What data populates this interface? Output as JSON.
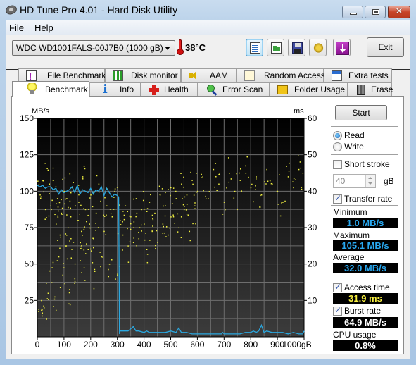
{
  "window": {
    "title": "HD Tune Pro 4.01 - Hard Disk Utility",
    "controls": {
      "minimize": "minimize",
      "maximize": "maximize",
      "close": "✕"
    }
  },
  "menu": [
    {
      "label": "File",
      "accel": "F"
    },
    {
      "label": "Help",
      "accel": "H"
    }
  ],
  "toolbar": {
    "drive": "WDC WD1001FALS-00J7B0 (1000 gB)",
    "temperature": "38°C",
    "buttons": [
      {
        "name": "copy-text",
        "icon": "copy-text-icon"
      },
      {
        "name": "copy-screenshot",
        "icon": "copy-screenshot-icon"
      },
      {
        "name": "save",
        "icon": "floppy-disk-icon"
      },
      {
        "name": "options",
        "icon": "gears-icon"
      },
      {
        "name": "minimize-to-tray",
        "icon": "download-arrow-icon"
      }
    ],
    "exit_label": "Exit"
  },
  "tabs_top": [
    {
      "label": "File Benchmark",
      "icon": "file-benchmark-icon"
    },
    {
      "label": "Disk monitor",
      "icon": "disk-monitor-icon"
    },
    {
      "label": "AAM",
      "icon": "speaker-icon"
    },
    {
      "label": "Random Access",
      "icon": "random-access-icon"
    },
    {
      "label": "Extra tests",
      "icon": "extra-tests-icon"
    }
  ],
  "tabs_bottom": [
    {
      "label": "Benchmark",
      "icon": "lightbulb-icon",
      "selected": true
    },
    {
      "label": "Info",
      "icon": "info-icon"
    },
    {
      "label": "Health",
      "icon": "health-cross-icon"
    },
    {
      "label": "Error Scan",
      "icon": "magnifier-icon"
    },
    {
      "label": "Folder Usage",
      "icon": "folder-icon"
    },
    {
      "label": "Erase",
      "icon": "trash-icon"
    }
  ],
  "benchmark": {
    "start_label": "Start",
    "mode_options": [
      {
        "label": "Read",
        "selected": true
      },
      {
        "label": "Write",
        "selected": false
      }
    ],
    "short_stroke": {
      "label": "Short stroke",
      "checked": false,
      "value": "40",
      "unit": "gB"
    },
    "transfer_rate": {
      "label": "Transfer rate",
      "checked": true
    },
    "minimum": {
      "label": "Minimum",
      "value": "1.0 MB/s"
    },
    "maximum": {
      "label": "Maximum",
      "value": "105.1 MB/s"
    },
    "average": {
      "label": "Average",
      "value": "32.0 MB/s"
    },
    "access_time": {
      "label": "Access time",
      "checked": true,
      "value": "31.9 ms"
    },
    "burst_rate": {
      "label": "Burst rate",
      "checked": true,
      "value": "64.9 MB/s"
    },
    "cpu_usage": {
      "label": "CPU usage",
      "value": "0.8%"
    }
  },
  "colors": {
    "transfer_line": "#2aa8e0",
    "access_dots": "#f0f040",
    "grid": "#6e6e6e",
    "readout_blue": "#28a8f0",
    "readout_yellow": "#f8f040"
  },
  "chart_data": {
    "type": "line",
    "title": "",
    "xlabel": "gB",
    "ylabel": "MB/s",
    "y2label": "ms",
    "xlim": [
      0,
      1000
    ],
    "ylim": [
      0,
      150
    ],
    "y2lim": [
      0,
      60
    ],
    "x_ticks": [
      "0",
      "100",
      "200",
      "300",
      "400",
      "500",
      "600",
      "700",
      "800",
      "900",
      "1000gB"
    ],
    "y_ticks": [
      "25",
      "50",
      "75",
      "100",
      "125",
      "150"
    ],
    "y2_ticks": [
      "10",
      "20",
      "30",
      "40",
      "50",
      "60"
    ],
    "grid": true,
    "series": [
      {
        "name": "Transfer rate (MB/s)",
        "axis": "left",
        "x": [
          0,
          10,
          20,
          30,
          40,
          50,
          60,
          70,
          80,
          90,
          100,
          110,
          120,
          130,
          140,
          150,
          160,
          170,
          180,
          190,
          200,
          210,
          220,
          230,
          240,
          250,
          260,
          270,
          280,
          290,
          300,
          305,
          308,
          310,
          320,
          340,
          360,
          370,
          380,
          400,
          410,
          420,
          450,
          480,
          500,
          520,
          530,
          540,
          560,
          580,
          600,
          650,
          690,
          695,
          700,
          760,
          780,
          800,
          810,
          820,
          830,
          840,
          850,
          860,
          880,
          900,
          920,
          940,
          960,
          980,
          995,
          1000
        ],
        "values": [
          104,
          103,
          104,
          102,
          103,
          103,
          101,
          102,
          98,
          101,
          99,
          100,
          101,
          103,
          99,
          104,
          98,
          101,
          100,
          99,
          102,
          98,
          101,
          100,
          103,
          97,
          102,
          99,
          96,
          98,
          97,
          96,
          2,
          4,
          4,
          4,
          7,
          4,
          4,
          3,
          4,
          3,
          3,
          3,
          4,
          3,
          6,
          3,
          3,
          2,
          2,
          2,
          2,
          3,
          2,
          2,
          3,
          3,
          4,
          3,
          4,
          8,
          3,
          4,
          3,
          3,
          3,
          2,
          3,
          2,
          2,
          4
        ]
      },
      {
        "name": "Access time (ms)",
        "axis": "right",
        "type": "scatter",
        "description": "~400 random seek samples; cluster 10-45 ms spread for 0-310 gB, 20-45 ms for 310-650 gB, 38-48 ms sparse above 650 gB",
        "points": [
          [
            5,
            7
          ],
          [
            10,
            39
          ],
          [
            15,
            10
          ],
          [
            20,
            43
          ],
          [
            25,
            8
          ],
          [
            30,
            35
          ],
          [
            40,
            12
          ],
          [
            45,
            42
          ],
          [
            50,
            36
          ],
          [
            55,
            19
          ],
          [
            60,
            43
          ],
          [
            65,
            11
          ],
          [
            70,
            31
          ],
          [
            75,
            38
          ],
          [
            80,
            22
          ],
          [
            85,
            28
          ],
          [
            90,
            34
          ],
          [
            95,
            17
          ],
          [
            100,
            40
          ],
          [
            105,
            25
          ],
          [
            110,
            38
          ],
          [
            115,
            30
          ],
          [
            120,
            13
          ],
          [
            125,
            33
          ],
          [
            130,
            41
          ],
          [
            135,
            26
          ],
          [
            140,
            16
          ],
          [
            150,
            32
          ],
          [
            155,
            37
          ],
          [
            160,
            21
          ],
          [
            165,
            29
          ],
          [
            170,
            44
          ],
          [
            175,
            19
          ],
          [
            180,
            35
          ],
          [
            190,
            24
          ],
          [
            195,
            31
          ],
          [
            200,
            39
          ],
          [
            210,
            27
          ],
          [
            215,
            18
          ],
          [
            220,
            34
          ],
          [
            230,
            42
          ],
          [
            240,
            22
          ],
          [
            250,
            29
          ],
          [
            260,
            36
          ],
          [
            270,
            20
          ],
          [
            280,
            33
          ],
          [
            290,
            40
          ],
          [
            300,
            17
          ],
          [
            310,
            32
          ],
          [
            320,
            28
          ],
          [
            330,
            36
          ],
          [
            340,
            25
          ],
          [
            350,
            33
          ],
          [
            360,
            30
          ],
          [
            370,
            38
          ],
          [
            380,
            27
          ],
          [
            390,
            35
          ],
          [
            400,
            31
          ],
          [
            410,
            24
          ],
          [
            420,
            37
          ],
          [
            430,
            29
          ],
          [
            440,
            34
          ],
          [
            450,
            26
          ],
          [
            460,
            39
          ],
          [
            470,
            31
          ],
          [
            480,
            36
          ],
          [
            490,
            28
          ],
          [
            500,
            41
          ],
          [
            510,
            33
          ],
          [
            520,
            38
          ],
          [
            530,
            30
          ],
          [
            540,
            42
          ],
          [
            550,
            35
          ],
          [
            560,
            39
          ],
          [
            570,
            29
          ],
          [
            580,
            43
          ],
          [
            590,
            36
          ],
          [
            600,
            40
          ],
          [
            620,
            44
          ],
          [
            640,
            38
          ],
          [
            660,
            46
          ],
          [
            680,
            42
          ],
          [
            700,
            37
          ],
          [
            720,
            45
          ],
          [
            740,
            40
          ],
          [
            760,
            43
          ],
          [
            780,
            47
          ],
          [
            800,
            41
          ],
          [
            820,
            44
          ],
          [
            840,
            39
          ],
          [
            860,
            46
          ],
          [
            880,
            42
          ],
          [
            900,
            40
          ],
          [
            920,
            37
          ],
          [
            940,
            44
          ],
          [
            960,
            41
          ],
          [
            980,
            46
          ],
          [
            995,
            45
          ]
        ]
      }
    ]
  }
}
